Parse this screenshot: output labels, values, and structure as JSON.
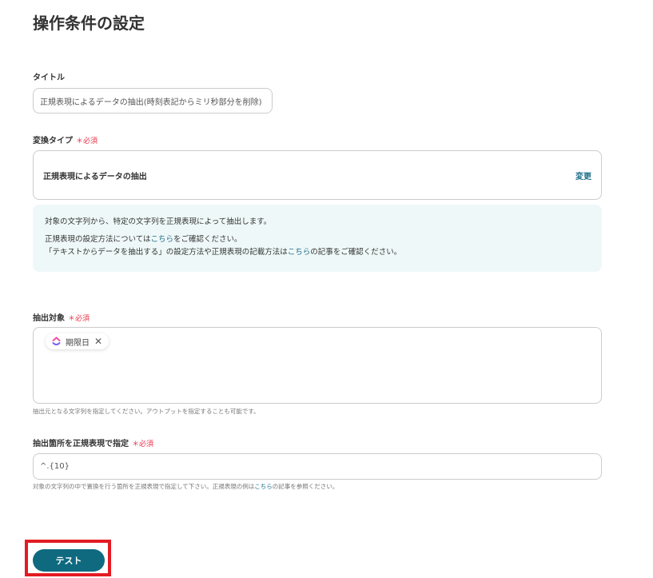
{
  "page_title": "操作条件の設定",
  "title_field": {
    "label": "タイトル",
    "value": "正規表現によるデータの抽出(時刻表記からミリ秒部分を削除)"
  },
  "conversion_type": {
    "label": "変換タイプ",
    "required": "＊必須",
    "value": "正規表現によるデータの抽出",
    "change_label": "変更"
  },
  "info": {
    "line1": "対象の文字列から、特定の文字列を正規表現によって抽出します。",
    "line2_pre": "正規表現の設定方法については",
    "line2_link": "こちら",
    "line2_post": "をご確認ください。",
    "line3_pre": "「テキストからデータを抽出する」の設定方法や正規表現の記載方法は",
    "line3_link": "こちら",
    "line3_post": "の記事をご確認ください。"
  },
  "target": {
    "label": "抽出対象",
    "required": "＊必須",
    "chip": "期限日",
    "hint": "抽出元となる文字列を指定してください。アウトプットを指定することも可能です。"
  },
  "regex": {
    "label": "抽出箇所を正規表現で指定",
    "required": "＊必須",
    "value": "^.{10}",
    "hint_pre": "対象の文字列の中で置換を行う箇所を正規表現で指定して下さい。正規表現の例は",
    "hint_link": "こちら",
    "hint_post": "の記事を参照ください。"
  },
  "test_button": "テスト"
}
